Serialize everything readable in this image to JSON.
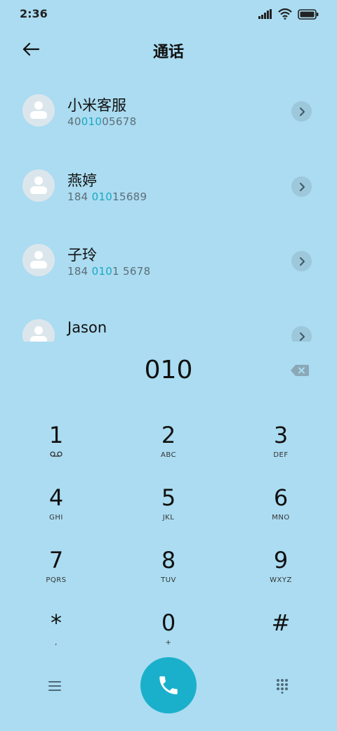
{
  "status_bar": {
    "time": "2:36",
    "icons": [
      "signal-icon",
      "wifi-icon",
      "battery-icon"
    ]
  },
  "header": {
    "title": "通话"
  },
  "contacts": [
    {
      "name": "小米客服",
      "number_parts": [
        "40",
        "010",
        "05678"
      ]
    },
    {
      "name": "燕婷",
      "number_parts": [
        "184 ",
        "010",
        "15689"
      ]
    },
    {
      "name": "子玲",
      "number_parts": [
        "184 ",
        "010",
        "1 5678"
      ]
    },
    {
      "name": "Jason",
      "number_parts": [
        "",
        "",
        ""
      ]
    }
  ],
  "dialer": {
    "number": "010"
  },
  "keypad": [
    {
      "digit": "1",
      "letters": ""
    },
    {
      "digit": "2",
      "letters": "ABC"
    },
    {
      "digit": "3",
      "letters": "DEF"
    },
    {
      "digit": "4",
      "letters": "GHI"
    },
    {
      "digit": "5",
      "letters": "JKL"
    },
    {
      "digit": "6",
      "letters": "MNO"
    },
    {
      "digit": "7",
      "letters": "PQRS"
    },
    {
      "digit": "8",
      "letters": "TUV"
    },
    {
      "digit": "9",
      "letters": "WXYZ"
    },
    {
      "digit": "*",
      "letters": ","
    },
    {
      "digit": "0",
      "letters": "+"
    },
    {
      "digit": "#",
      "letters": ""
    }
  ],
  "colors": {
    "background": "#abdcf1",
    "highlight": "#1aa7c4",
    "call_button": "#1ab0cb"
  }
}
